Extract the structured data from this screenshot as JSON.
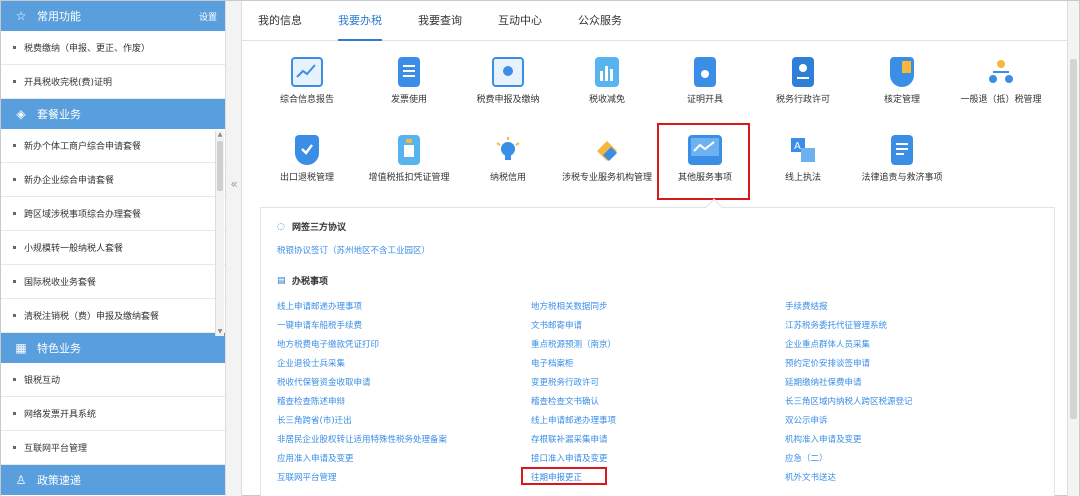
{
  "sidebar": {
    "sections": [
      {
        "title": "常用功能",
        "right": "设置",
        "items": [
          "税费缴纳（申报、更正、作废）",
          "开具税收完税(费)证明"
        ]
      },
      {
        "title": "套餐业务",
        "items": [
          "新办个体工商户综合申请套餐",
          "新办企业综合申请套餐",
          "跨区域涉税事项综合办理套餐",
          "小规模转一般纳税人套餐",
          "国际税收业务套餐",
          "清税注销税（费）申报及缴纳套餐"
        ]
      },
      {
        "title": "特色业务",
        "items": [
          "银税互动",
          "网络发票开具系统",
          "互联网平台管理"
        ]
      },
      {
        "title": "政策速递",
        "items": []
      }
    ]
  },
  "tabs": [
    "我的信息",
    "我要办税",
    "我要查询",
    "互动中心",
    "公众服务"
  ],
  "active_tab": "我要办税",
  "grid": {
    "row1": [
      "综合信息报告",
      "发票使用",
      "税费申报及缴纳",
      "税收减免",
      "证明开具",
      "税务行政许可",
      "核定管理",
      "一般退（抵）税管理"
    ],
    "row2": [
      "出口退税管理",
      "增值税抵扣凭证管理",
      "纳税信用",
      "涉税专业服务机构管理",
      "其他服务事项",
      "线上执法",
      "法律追责与救济事项"
    ],
    "selected": "其他服务事项"
  },
  "panel": {
    "sec1_title": "网签三方协议",
    "sec1_link": "税银协议签订（苏州地区不含工业园区）",
    "sec2_title": "办税事项",
    "col1": [
      "线上申请邮递办理事项",
      "一键申请车船税手续费",
      "地方税费电子缴款凭证打印",
      "企业退役士兵采集",
      "税收代保管资金收取申请",
      "稽查检查陈述申辩",
      "长三角跨省(市)迁出",
      "非居民企业股权转让适用特殊性税务处理备案",
      "应用准入申请及变更",
      "互联网平台管理"
    ],
    "col2": [
      "地方税相关数据同步",
      "文书邮寄申请",
      "重点税源预测（南京）",
      "电子档案柜",
      "变更税务行政许可",
      "稽查检查文书确认",
      "线上申请邮递办理事项",
      "存根联补漏采集申请",
      "接口准入申请及变更",
      "往期申报更正"
    ],
    "col3": [
      "手续费结报",
      "江苏税务委托代征管理系统",
      "企业重点群体人员采集",
      "预约定价安排谈签申请",
      "延期缴纳社保费申请",
      "长三角区域内纳税人跨区税源登记",
      "双公示申诉",
      "机构准入申请及变更",
      "应急（二）",
      "机外文书送达"
    ],
    "highlighted": "往期申报更正"
  }
}
